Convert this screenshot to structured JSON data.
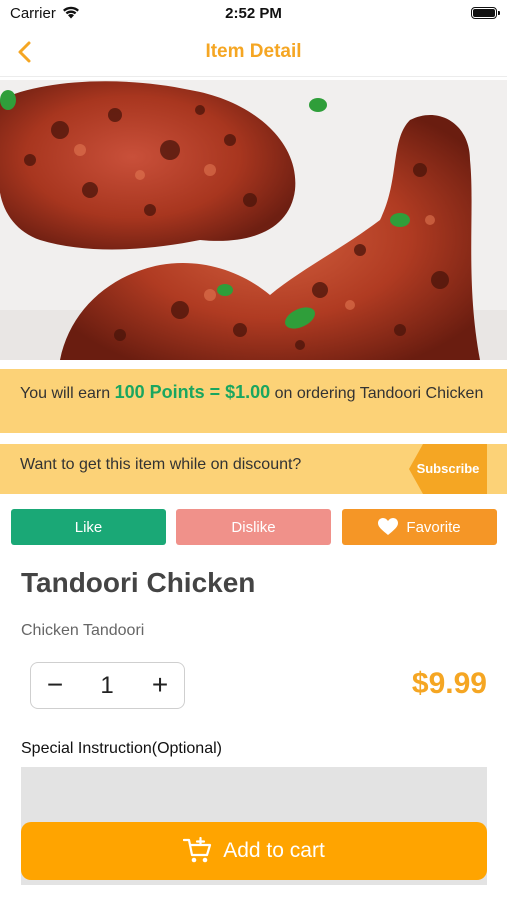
{
  "status_bar": {
    "carrier": "Carrier",
    "time": "2:52 PM"
  },
  "nav": {
    "title": "Item Detail",
    "back_icon": "chevron-left-icon"
  },
  "points_banner": {
    "prefix": "You will earn ",
    "highlight": "100 Points = $1.00",
    "suffix": " on ordering Tandoori Chicken"
  },
  "discount_banner": {
    "text": "Want to get this item while on discount?",
    "subscribe_label": "Subscribe"
  },
  "actions": {
    "like": "Like",
    "dislike": "Dislike",
    "favorite": "Favorite"
  },
  "item": {
    "title": "Tandoori Chicken",
    "subtitle": "Chicken Tandoori",
    "price": "$9.99"
  },
  "quantity": {
    "minus": "−",
    "value": "1",
    "plus": "+"
  },
  "special_instruction": {
    "label": "Special Instruction(Optional)",
    "value": ""
  },
  "cart": {
    "label": "Add to cart",
    "icon": "cart-add-icon"
  },
  "colors": {
    "accent": "#f5a623",
    "banner": "#fcd277",
    "points_green": "#1aa65f",
    "like": "#1aa876",
    "dislike": "#f0918a",
    "favorite": "#f59626",
    "cart": "#ffa400"
  }
}
